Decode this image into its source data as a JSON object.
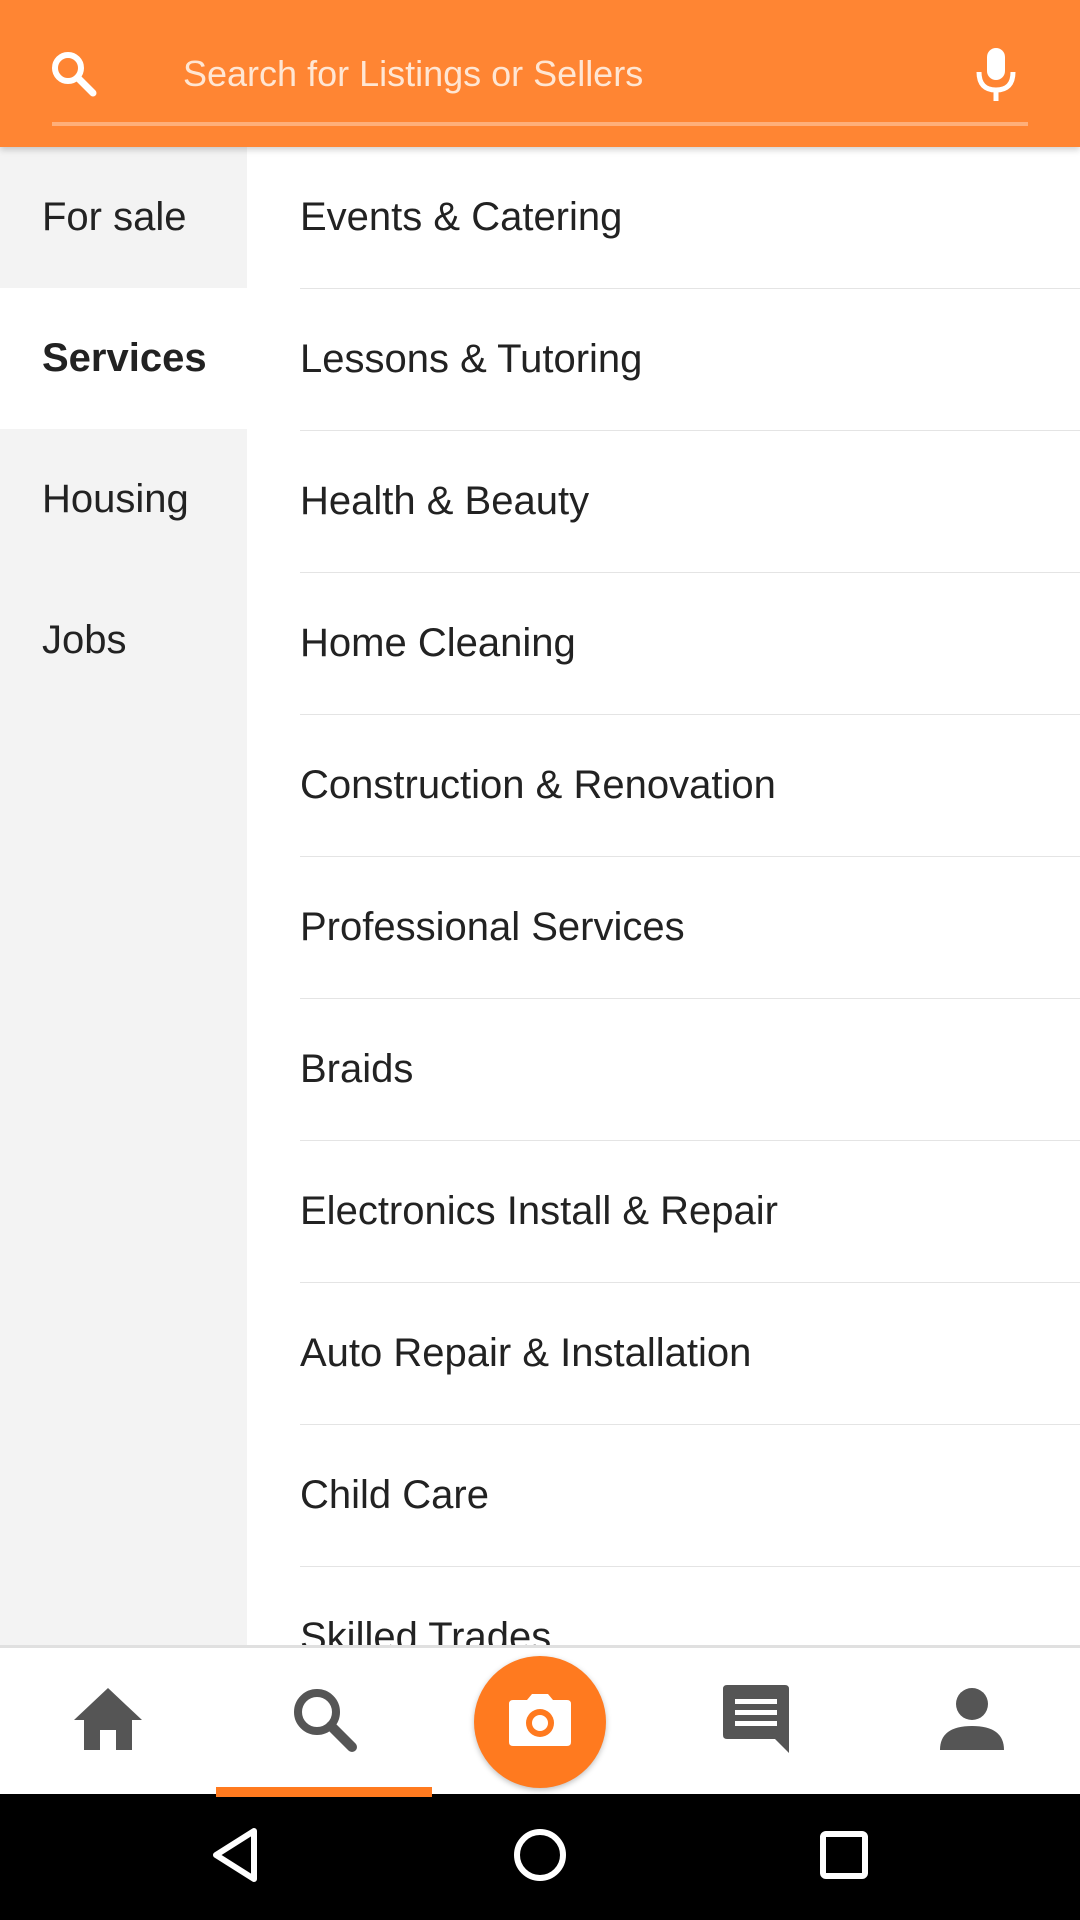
{
  "search": {
    "placeholder": "Search for Listings or Sellers",
    "value": ""
  },
  "sidebar": {
    "items": [
      {
        "label": "For sale",
        "active": false
      },
      {
        "label": "Services",
        "active": true
      },
      {
        "label": "Housing",
        "active": false
      },
      {
        "label": "Jobs",
        "active": false
      }
    ]
  },
  "subcategories": [
    {
      "label": "Events & Catering"
    },
    {
      "label": "Lessons & Tutoring"
    },
    {
      "label": "Health & Beauty"
    },
    {
      "label": "Home Cleaning"
    },
    {
      "label": "Construction & Renovation"
    },
    {
      "label": "Professional Services"
    },
    {
      "label": "Braids"
    },
    {
      "label": "Electronics Install & Repair"
    },
    {
      "label": "Auto Repair & Installation"
    },
    {
      "label": "Child Care"
    },
    {
      "label": "Skilled Trades"
    }
  ],
  "bottom_nav": {
    "active": "search",
    "items": [
      {
        "id": "home",
        "icon": "home-icon"
      },
      {
        "id": "search",
        "icon": "search-icon"
      },
      {
        "id": "camera",
        "icon": "camera-icon"
      },
      {
        "id": "messages",
        "icon": "chat-icon"
      },
      {
        "id": "profile",
        "icon": "person-icon"
      }
    ]
  },
  "colors": {
    "header": "#ff8533",
    "accent": "#ff7a1f",
    "sidebar_bg": "#f3f3f3",
    "nav_icon": "#555555",
    "text": "#222222"
  }
}
